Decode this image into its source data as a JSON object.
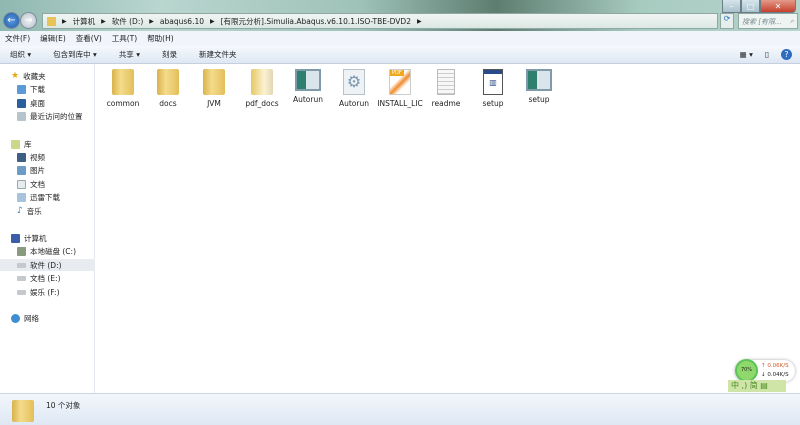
{
  "address": {
    "crumbs": [
      "计算机",
      "软件 (D:)",
      "abaqus6.10",
      "[有限元分析].Simulia.Abaqus.v6.10.1.ISO-TBE-DVD2"
    ]
  },
  "search": {
    "placeholder": "搜索 [有限..."
  },
  "menu": [
    "文件(F)",
    "编辑(E)",
    "查看(V)",
    "工具(T)",
    "帮助(H)"
  ],
  "toolbar": [
    "组织 ▾",
    "包含到库中 ▾",
    "共享 ▾",
    "刻录",
    "新建文件夹"
  ],
  "sidebar": {
    "favorites": {
      "label": "收藏夹",
      "items": [
        "下载",
        "桌面",
        "最近访问的位置"
      ]
    },
    "libraries": {
      "label": "库",
      "items": [
        "视频",
        "图片",
        "文档",
        "迅雷下载",
        "音乐"
      ]
    },
    "computer": {
      "label": "计算机",
      "items": [
        "本地磁盘 (C:)",
        "软件 (D:)",
        "文档 (E:)",
        "娱乐 (F:)"
      ]
    },
    "network": {
      "label": "网络"
    }
  },
  "files": [
    {
      "name": "common",
      "icon": "folder-icon"
    },
    {
      "name": "docs",
      "icon": "folder-icon"
    },
    {
      "name": "JVM",
      "icon": "folder-icon"
    },
    {
      "name": "pdf_docs",
      "icon": "folder-icon"
    },
    {
      "name": "Autorun",
      "icon": "application-icon"
    },
    {
      "name": "Autorun",
      "icon": "settings-file-icon"
    },
    {
      "name": "INSTALL_LIC",
      "icon": "pdf-icon"
    },
    {
      "name": "readme",
      "icon": "text-file-icon"
    },
    {
      "name": "setup",
      "icon": "setup-window-icon"
    },
    {
      "name": "setup",
      "icon": "application-icon"
    }
  ],
  "status": {
    "count": "10 个对象"
  },
  "netmon": {
    "percent": "70%",
    "up": "↑ 0.06K/S",
    "down": "↓ 0.04K/S"
  },
  "ime": "中 ,) 简 ▤"
}
